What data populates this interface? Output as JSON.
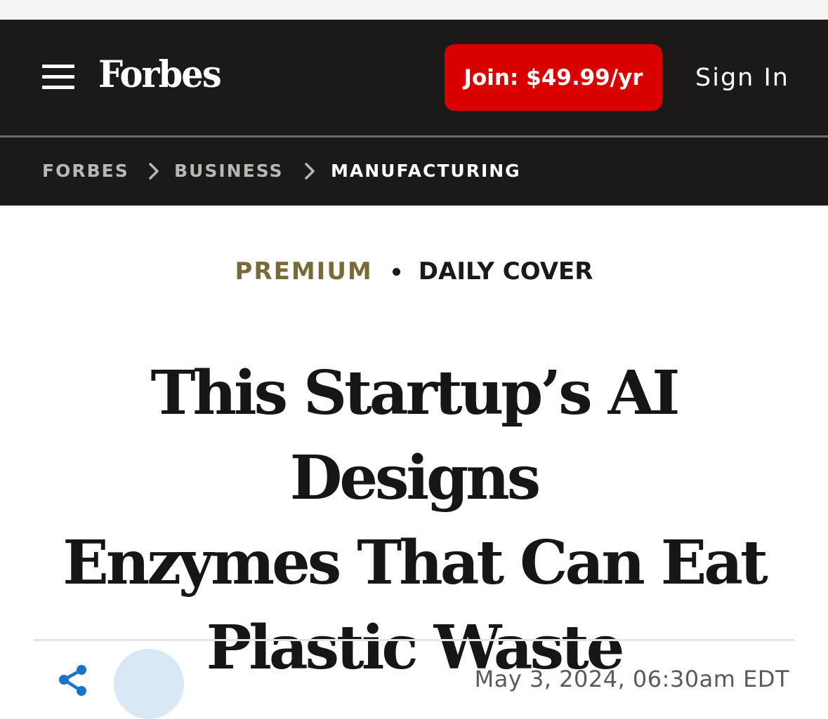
{
  "header": {
    "logo_text": "Forbes",
    "join_label": "Join: $49.99/yr",
    "signin_label": "Sign In",
    "icons": [
      "menu-icon"
    ],
    "colors": {
      "header_bg": "#1c1a19",
      "join_bg": "#d90000"
    }
  },
  "breadcrumb": {
    "items": [
      {
        "label": "FORBES"
      },
      {
        "label": "BUSINESS"
      },
      {
        "label": "MANUFACTURING"
      }
    ],
    "separator_icon": "chevron-right-icon"
  },
  "tags": {
    "premium": "PREMIUM",
    "daily_cover": "DAILY COVER",
    "premium_color": "#7a6a38"
  },
  "article": {
    "headline_lines": [
      "This Startup’s AI Designs",
      "Enzymes That Can Eat",
      "Plastic Waste"
    ],
    "date": "May 3, 2024, 06:30am EDT"
  },
  "byline": {
    "share_icon": "share-icon",
    "share_color": "#1a73c8",
    "avatar_color": "#d9e8f5"
  }
}
